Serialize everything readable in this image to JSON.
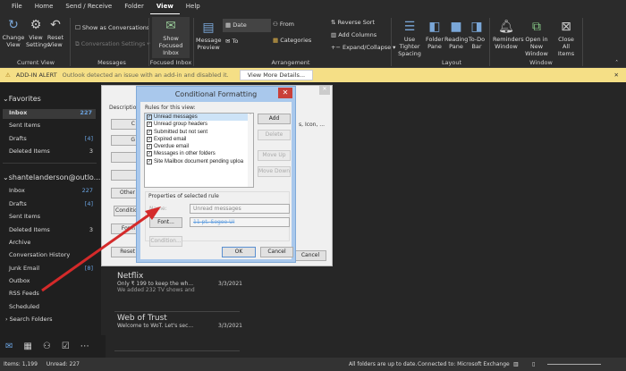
{
  "tabs": [
    "File",
    "Home",
    "Send / Receive",
    "Folder",
    "View",
    "Help"
  ],
  "ribbon": {
    "change_view": "Change View",
    "view_settings": "View Settings",
    "reset_view": "Reset View",
    "current_view_group": "Current View",
    "show_conversations": "Show as Conversations",
    "conversation_settings": "Conversation Settings",
    "messages_group": "Messages",
    "show_focused": "Show Focused Inbox",
    "focused_group": "Focused Inbox",
    "message_preview": "Message Preview",
    "date": "Date",
    "to": "To",
    "from": "From",
    "categories": "Categories",
    "reverse_sort": "Reverse Sort",
    "add_columns": "Add Columns",
    "expand_collapse": "Expand/Collapse",
    "arrangement_group": "Arrangement",
    "tighter": "Use Tighter Spacing",
    "folder_pane": "Folder Pane",
    "reading_pane": "Reading Pane",
    "todo_bar": "To-Do Bar",
    "layout_group": "Layout",
    "reminders": "Reminders Window",
    "open_new": "Open in New Window",
    "close_all": "Close All Items",
    "window_group": "Window"
  },
  "alert": {
    "title": "ADD-IN ALERT",
    "text": "Outlook detected an issue with an add-in and disabled it.",
    "button": "View More Details..."
  },
  "sidebar": {
    "favorites": "Favorites",
    "fav": [
      {
        "label": "Inbox",
        "count": "227"
      },
      {
        "label": "Sent Items",
        "count": ""
      },
      {
        "label": "Drafts",
        "count": "[4]"
      },
      {
        "label": "Deleted Items",
        "count": "3"
      }
    ],
    "account": "shantelanderson@outlo...",
    "folders": [
      {
        "label": "Inbox",
        "count": "227"
      },
      {
        "label": "Drafts",
        "count": "[4]"
      },
      {
        "label": "Sent Items",
        "count": ""
      },
      {
        "label": "Deleted Items",
        "count": "3"
      },
      {
        "label": "Archive",
        "count": ""
      },
      {
        "label": "Conversation History",
        "count": ""
      },
      {
        "label": "Junk Email",
        "count": "[8]"
      },
      {
        "label": "Outbox",
        "count": ""
      },
      {
        "label": "RSS Feeds",
        "count": ""
      },
      {
        "label": "Scheduled",
        "count": ""
      }
    ],
    "search_folders": "Search Folders"
  },
  "messages": [
    {
      "sender": "Netflix",
      "subject": "Only ₹ 199 to keep the wh...",
      "date": "3/3/2021",
      "preview": "We added 232 TV shows and"
    },
    {
      "sender": "Web of Trust",
      "subject": "Welcome to WoT. Let's sec...",
      "date": "3/3/2021",
      "preview": ""
    }
  ],
  "bg_dialog": {
    "description": "Description",
    "buttons": [
      "C",
      "G",
      "",
      "",
      "Other",
      "Conditio",
      "Form",
      "Reset"
    ],
    "right_text": "s, Icon, ...",
    "cancel": "Cancel"
  },
  "dialog": {
    "title": "Conditional Formatting",
    "rules_label": "Rules for this view:",
    "rules": [
      "Unread messages",
      "Unread group headers",
      "Submitted but not sent",
      "Expired email",
      "Overdue email",
      "Messages in other folders",
      "Site Mailbox document pending uploa"
    ],
    "add": "Add",
    "delete": "Delete",
    "move_up": "Move Up",
    "move_down": "Move Down",
    "properties": "Properties of selected rule",
    "name_label": "Name:",
    "name_value": "Unread messages",
    "font": "Font...",
    "font_value": "11 pt. Segoe UI",
    "condition": "Condition...",
    "ok": "OK",
    "cancel": "Cancel"
  },
  "status": {
    "items": "Items: 1,199",
    "unread": "Unread: 227",
    "uptodate": "All folders are up to date.",
    "connected": "Connected to: Microsoft Exchange"
  }
}
